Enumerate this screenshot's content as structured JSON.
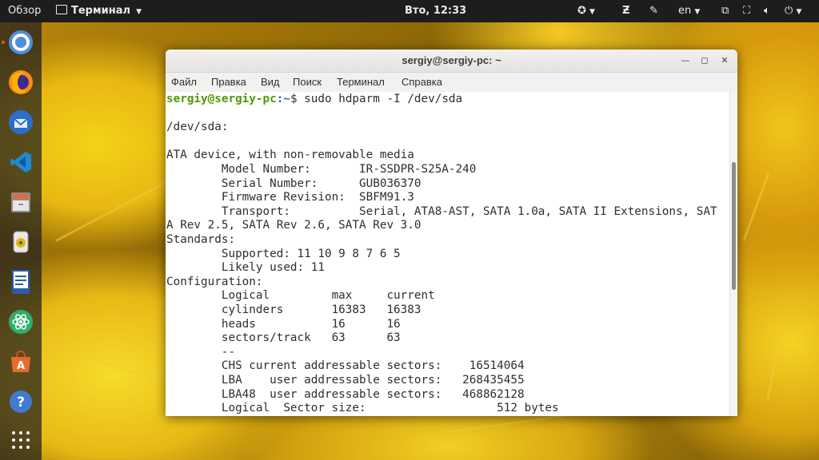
{
  "topbar": {
    "overview_label": "Обзор",
    "app_menu_label": "Терминал",
    "clock": "Вто, 12:33",
    "language": "en"
  },
  "dock": {
    "apps": [
      {
        "name": "chromium-icon",
        "active": true
      },
      {
        "name": "firefox-icon"
      },
      {
        "name": "thunderbird-icon"
      },
      {
        "name": "vscode-icon"
      },
      {
        "name": "file-manager-icon"
      },
      {
        "name": "rhythmbox-icon"
      },
      {
        "name": "writer-icon"
      },
      {
        "name": "atom-icon"
      },
      {
        "name": "software-center-icon"
      },
      {
        "name": "help-icon"
      },
      {
        "name": "show-apps-icon"
      }
    ]
  },
  "window": {
    "title": "sergiy@sergiy-pc: ~",
    "menu": [
      "Файл",
      "Правка",
      "Вид",
      "Поиск",
      "Терминал",
      "Справка"
    ]
  },
  "terminal": {
    "prompt_user": "sergiy@sergiy-pc",
    "prompt_path": ":~",
    "prompt_symbol": "$ ",
    "command": "sudo hdparm -I /dev/sda",
    "lines": [
      "",
      "/dev/sda:",
      "",
      "ATA device, with non-removable media",
      "        Model Number:       IR-SSDPR-S25A-240",
      "        Serial Number:      GUB036370",
      "        Firmware Revision:  SBFM91.3",
      "        Transport:          Serial, ATA8-AST, SATA 1.0a, SATA II Extensions, SAT",
      "A Rev 2.5, SATA Rev 2.6, SATA Rev 3.0",
      "Standards:",
      "        Supported: 11 10 9 8 7 6 5",
      "        Likely used: 11",
      "Configuration:",
      "        Logical         max     current",
      "        cylinders       16383   16383",
      "        heads           16      16",
      "        sectors/track   63      63",
      "        --",
      "        CHS current addressable sectors:    16514064",
      "        LBA    user addressable sectors:   268435455",
      "        LBA48  user addressable sectors:   468862128",
      "        Logical  Sector size:                   512 bytes"
    ]
  }
}
